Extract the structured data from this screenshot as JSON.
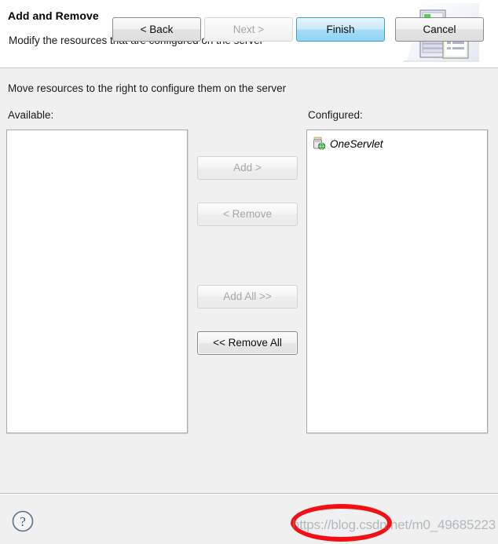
{
  "header": {
    "title": "Add and Remove",
    "subtitle": "Modify the resources that are configured on the server",
    "icon": "server-document-banner-icon"
  },
  "main": {
    "instruction": "Move resources to the right to configure them on the server",
    "available_label": "Available:",
    "configured_label": "Configured:",
    "available_items": [],
    "configured_items": [
      {
        "label": "OneServlet",
        "icon": "web-module-icon"
      }
    ]
  },
  "transfer_buttons": [
    {
      "label": "Add >",
      "enabled": false
    },
    {
      "label": "< Remove",
      "enabled": false
    },
    {
      "label": "Add All >>",
      "enabled": false
    },
    {
      "label": "<< Remove All",
      "enabled": true
    }
  ],
  "footer": {
    "help_icon": "help-question-icon",
    "back_label": "< Back",
    "next_label": "Next >",
    "finish_label": "Finish",
    "cancel_label": "Cancel",
    "watermark": "https://blog.csdn.net/m0_49685223"
  },
  "colors": {
    "dialog_background": "#f0f0f0",
    "header_background": "#ffffff",
    "list_background": "#ffffff",
    "list_border": "#a7acb3",
    "primary_button_border": "#3c9fd4",
    "primary_button_fill": "#a6ddf6",
    "annotation_red": "#f50f15",
    "disabled_text": "#a6a6a6",
    "enabled_text": "#0d0d0d"
  }
}
